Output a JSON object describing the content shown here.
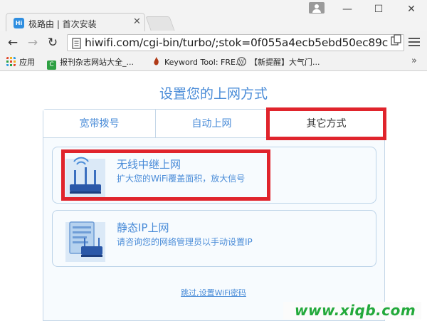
{
  "browser": {
    "tab_title": "极路由 | 首次安装",
    "tab_favicon": "Hi",
    "url": "hiwifi.com/cgi-bin/turbo/;stok=0f055a4ecb5ebd50ec89c",
    "bookmarks": [
      {
        "label": "应用",
        "icon": "apps-grid-icon",
        "color": "#e0472a"
      },
      {
        "label": "报刊杂志网站大全_...",
        "icon": "green-c-icon",
        "color": "#2ea043"
      },
      {
        "label": "Keyword Tool: FRE...",
        "icon": "flame-icon",
        "color": "#b03a17"
      },
      {
        "label": "【新提醒】大气门...",
        "icon": "wordpress-icon",
        "color": "#555555"
      }
    ]
  },
  "page": {
    "title": "设置您的上网方式",
    "tabs": [
      {
        "label": "宽带拨号"
      },
      {
        "label": "自动上网"
      },
      {
        "label": "其它方式"
      }
    ],
    "active_tab": "其它方式",
    "options": [
      {
        "title": "无线中继上网",
        "desc": "扩大您的WiFi覆盖面积，放大信号",
        "icon": "wireless-repeater-icon"
      },
      {
        "title": "静态IP上网",
        "desc": "请咨询您的网络管理员以手动设置IP",
        "icon": "static-ip-icon"
      }
    ],
    "skip_link": "跳过,设置WiFi密码"
  },
  "watermark": "www.xiqb.com",
  "colors": {
    "accent": "#4a8cd8",
    "highlight": "#e0242c",
    "watermark": "#23a93b"
  }
}
